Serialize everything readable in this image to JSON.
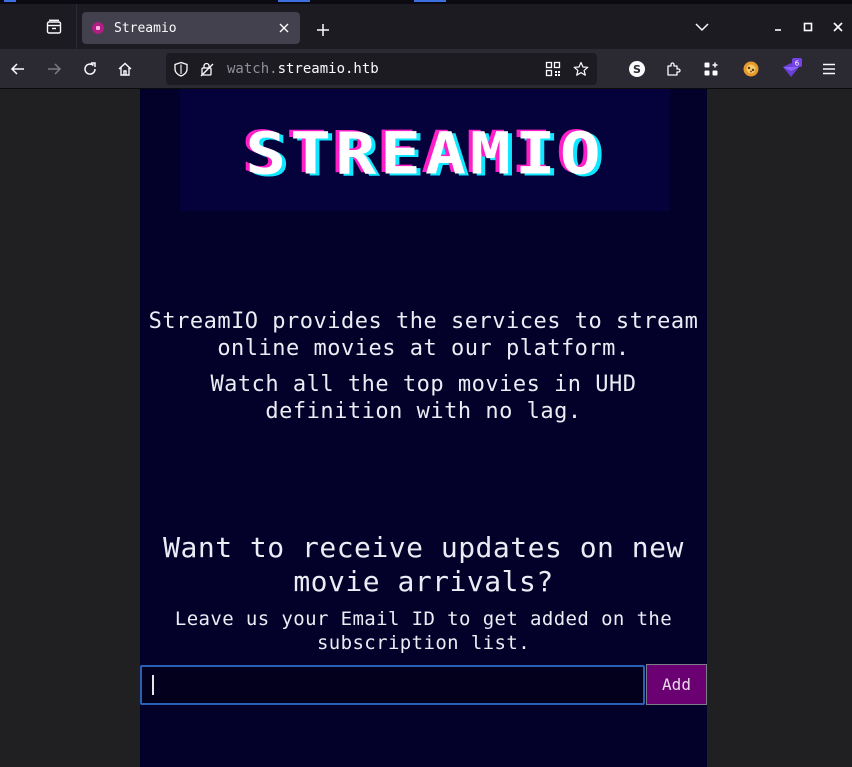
{
  "browser": {
    "tab": {
      "title": "Streamio"
    },
    "url": {
      "prefix": "watch.",
      "domain": "streamio.htb"
    },
    "extensions": {
      "badge_count": "6"
    }
  },
  "page": {
    "logo_text": "STREAMIO",
    "description_1": "StreamIO provides the services to stream online movies at our platform.",
    "description_2": "Watch all the top movies in UHD definition with no lag.",
    "heading": "Want to receive updates on new movie arrivals?",
    "subline": "Leave us your Email ID to get added on the subscription list.",
    "email_input": {
      "value": "",
      "placeholder": ""
    },
    "add_label": "Add"
  },
  "colors": {
    "page_bg": "#03002a",
    "add_button": "#6a0072",
    "input_border": "#2a5fb6",
    "logo_pink": "#ff1ec8",
    "logo_cyan": "#10e6ff"
  }
}
